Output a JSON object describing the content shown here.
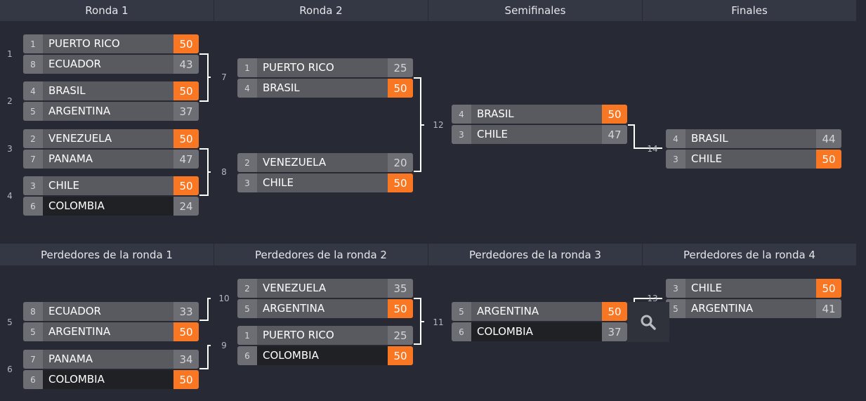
{
  "headers": {
    "winners": [
      "Ronda 1",
      "Ronda 2",
      "Semifinales",
      "Finales"
    ],
    "losers": [
      "Perdedores de la ronda 1",
      "Perdedores de la ronda 2",
      "Perdedores de la ronda 3",
      "Perdedores de la ronda 4"
    ]
  },
  "colors": {
    "background": "#272a35",
    "header": "#343845",
    "winner_score": "#f97623",
    "team_row": "#585a60",
    "seed_box": "#6c6e73",
    "connector": "#ffffff"
  },
  "icons": {
    "zoom": "magnifier-icon"
  },
  "matches": [
    {
      "num": "1",
      "teams": [
        {
          "seed": "1",
          "name": "PUERTO RICO",
          "score": "50",
          "win": true
        },
        {
          "seed": "8",
          "name": "ECUADOR",
          "score": "43",
          "win": false
        }
      ]
    },
    {
      "num": "2",
      "teams": [
        {
          "seed": "4",
          "name": "BRASIL",
          "score": "50",
          "win": true
        },
        {
          "seed": "5",
          "name": "ARGENTINA",
          "score": "37",
          "win": false
        }
      ]
    },
    {
      "num": "3",
      "teams": [
        {
          "seed": "2",
          "name": "VENEZUELA",
          "score": "50",
          "win": true
        },
        {
          "seed": "7",
          "name": "PANAMA",
          "score": "47",
          "win": false
        }
      ]
    },
    {
      "num": "4",
      "teams": [
        {
          "seed": "3",
          "name": "CHILE",
          "score": "50",
          "win": true
        },
        {
          "seed": "6",
          "name": "COLOMBIA",
          "score": "24",
          "win": false,
          "dark": true
        }
      ]
    },
    {
      "num": "7",
      "teams": [
        {
          "seed": "1",
          "name": "PUERTO RICO",
          "score": "25",
          "win": false
        },
        {
          "seed": "4",
          "name": "BRASIL",
          "score": "50",
          "win": true
        }
      ]
    },
    {
      "num": "8",
      "teams": [
        {
          "seed": "2",
          "name": "VENEZUELA",
          "score": "20",
          "win": false
        },
        {
          "seed": "3",
          "name": "CHILE",
          "score": "50",
          "win": true
        }
      ]
    },
    {
      "num": "12",
      "teams": [
        {
          "seed": "4",
          "name": "BRASIL",
          "score": "50",
          "win": true
        },
        {
          "seed": "3",
          "name": "CHILE",
          "score": "47",
          "win": false
        }
      ]
    },
    {
      "num": "14",
      "teams": [
        {
          "seed": "4",
          "name": "BRASIL",
          "score": "44",
          "win": false
        },
        {
          "seed": "3",
          "name": "CHILE",
          "score": "50",
          "win": true
        }
      ]
    },
    {
      "num": "5",
      "teams": [
        {
          "seed": "8",
          "name": "ECUADOR",
          "score": "33",
          "win": false
        },
        {
          "seed": "5",
          "name": "ARGENTINA",
          "score": "50",
          "win": true
        }
      ]
    },
    {
      "num": "6",
      "teams": [
        {
          "seed": "7",
          "name": "PANAMA",
          "score": "34",
          "win": false
        },
        {
          "seed": "6",
          "name": "COLOMBIA",
          "score": "50",
          "win": true,
          "dark": true
        }
      ]
    },
    {
      "num": "10",
      "teams": [
        {
          "seed": "2",
          "name": "VENEZUELA",
          "score": "35",
          "win": false
        },
        {
          "seed": "5",
          "name": "ARGENTINA",
          "score": "50",
          "win": true
        }
      ]
    },
    {
      "num": "9",
      "teams": [
        {
          "seed": "1",
          "name": "PUERTO RICO",
          "score": "25",
          "win": false
        },
        {
          "seed": "6",
          "name": "COLOMBIA",
          "score": "50",
          "win": true,
          "dark": true
        }
      ]
    },
    {
      "num": "11",
      "teams": [
        {
          "seed": "5",
          "name": "ARGENTINA",
          "score": "50",
          "win": true
        },
        {
          "seed": "6",
          "name": "COLOMBIA",
          "score": "37",
          "win": false,
          "dark": true
        }
      ]
    },
    {
      "num": "13",
      "teams": [
        {
          "seed": "3",
          "name": "CHILE",
          "score": "50",
          "win": true
        },
        {
          "seed": "5",
          "name": "ARGENTINA",
          "score": "41",
          "win": false
        }
      ]
    }
  ]
}
